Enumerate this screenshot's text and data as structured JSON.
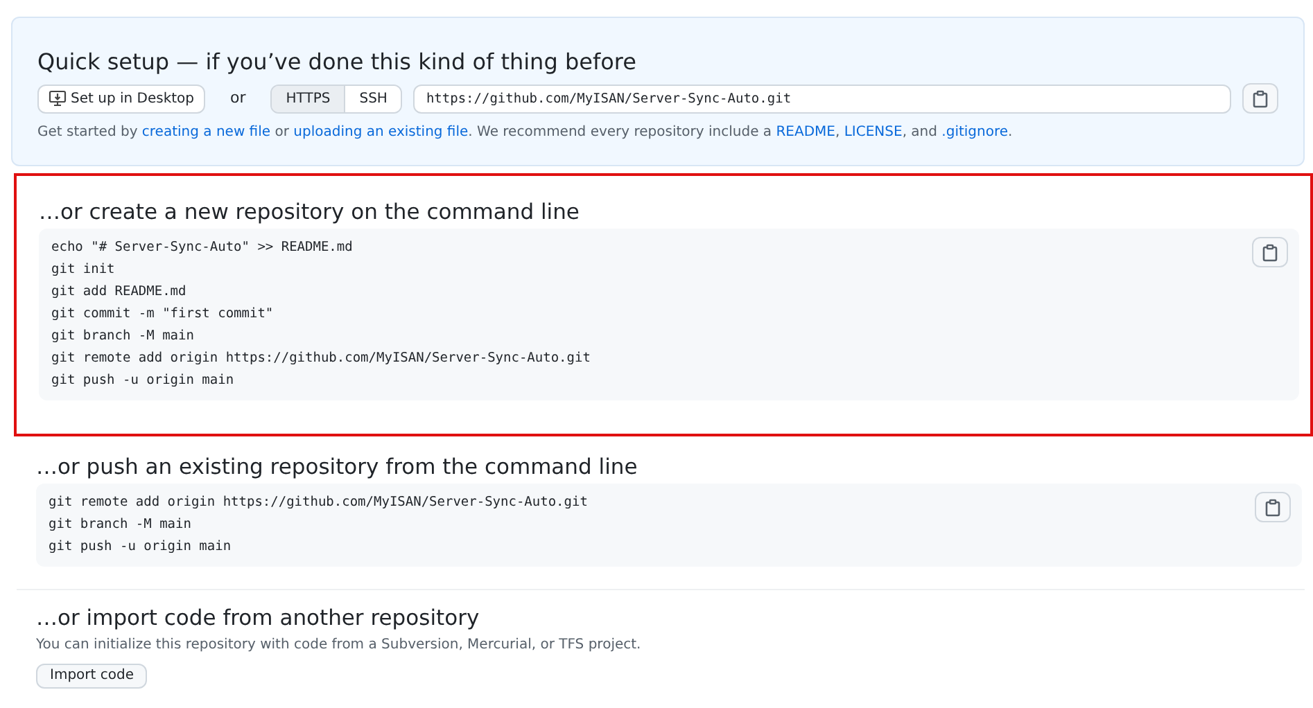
{
  "quick_setup": {
    "title": "Quick setup — if you’ve done this kind of thing before",
    "desktop_button": "Set up in Desktop",
    "or": "or",
    "protocols": [
      {
        "label": "HTTPS",
        "selected": true
      },
      {
        "label": "SSH",
        "selected": false
      }
    ],
    "url": "https://github.com/MyISAN/Server-Sync-Auto.git",
    "hint": [
      {
        "kind": "text",
        "text": "Get started by "
      },
      {
        "kind": "link",
        "text": "creating a new file"
      },
      {
        "kind": "text",
        "text": " or "
      },
      {
        "kind": "link",
        "text": "uploading an existing file"
      },
      {
        "kind": "text",
        "text": ". We recommend every repository include a "
      },
      {
        "kind": "link",
        "text": "README"
      },
      {
        "kind": "text",
        "text": ", "
      },
      {
        "kind": "link",
        "text": "LICENSE"
      },
      {
        "kind": "text",
        "text": ", and "
      },
      {
        "kind": "link",
        "text": ".gitignore"
      },
      {
        "kind": "text",
        "text": "."
      }
    ]
  },
  "sections": [
    {
      "kind": "code",
      "highlighted": true,
      "title": "…or create a new repository on the command line",
      "lines": [
        "echo \"# Server-Sync-Auto\" >> README.md",
        "git init",
        "git add README.md",
        "git commit -m \"first commit\"",
        "git branch -M main",
        "git remote add origin https://github.com/MyISAN/Server-Sync-Auto.git",
        "git push -u origin main"
      ]
    },
    {
      "kind": "code",
      "highlighted": false,
      "title": "…or push an existing repository from the command line",
      "lines": [
        "git remote add origin https://github.com/MyISAN/Server-Sync-Auto.git",
        "git branch -M main",
        "git push -u origin main"
      ]
    },
    {
      "kind": "import",
      "highlighted": false,
      "title": "…or import code from another repository",
      "description": "You can initialize this repository with code from a Subversion, Mercurial, or TFS project.",
      "button": "Import code"
    }
  ]
}
